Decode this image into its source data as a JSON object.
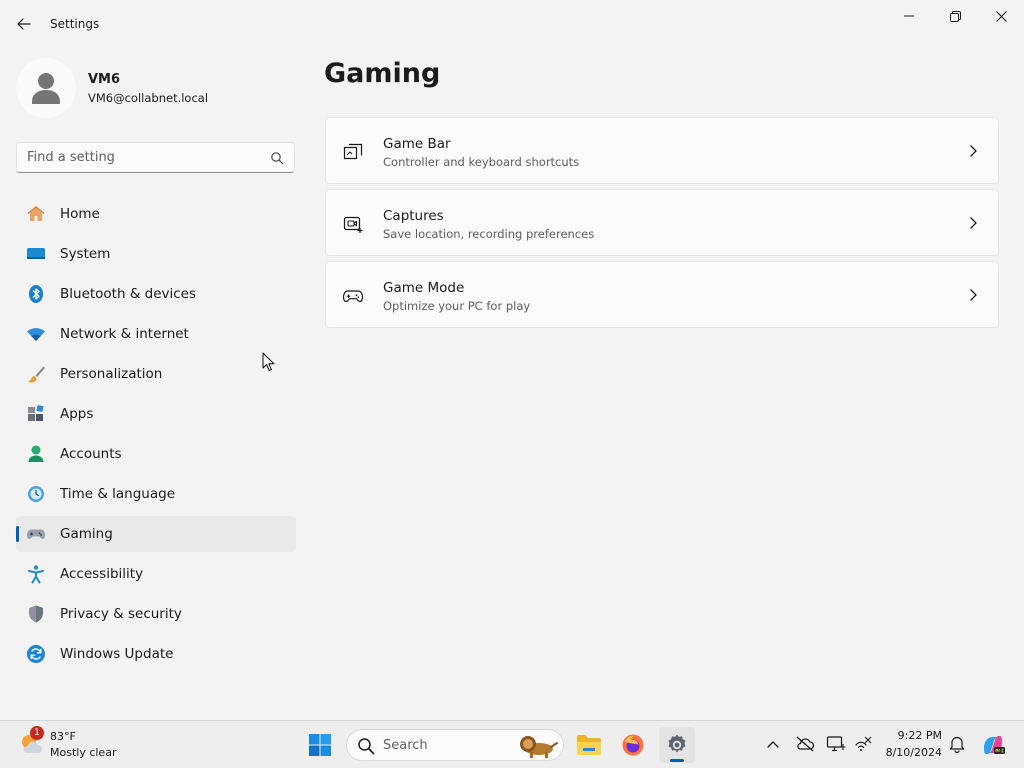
{
  "window": {
    "title": "Settings"
  },
  "profile": {
    "name": "VM6",
    "email": "VM6@collabnet.local"
  },
  "search": {
    "placeholder": "Find a setting"
  },
  "sidebar": {
    "items": [
      {
        "label": "Home",
        "icon": "home-icon"
      },
      {
        "label": "System",
        "icon": "display-icon"
      },
      {
        "label": "Bluetooth & devices",
        "icon": "bluetooth-icon"
      },
      {
        "label": "Network & internet",
        "icon": "wifi-icon"
      },
      {
        "label": "Personalization",
        "icon": "brush-icon"
      },
      {
        "label": "Apps",
        "icon": "apps-icon"
      },
      {
        "label": "Accounts",
        "icon": "person-icon"
      },
      {
        "label": "Time & language",
        "icon": "clock-globe-icon"
      },
      {
        "label": "Gaming",
        "icon": "gamepad-icon",
        "active": true
      },
      {
        "label": "Accessibility",
        "icon": "accessibility-icon"
      },
      {
        "label": "Privacy & security",
        "icon": "shield-icon"
      },
      {
        "label": "Windows Update",
        "icon": "refresh-icon"
      }
    ]
  },
  "main": {
    "title": "Gaming",
    "cards": [
      {
        "title": "Game Bar",
        "description": "Controller and keyboard shortcuts",
        "icon": "game-bar-icon"
      },
      {
        "title": "Captures",
        "description": "Save location, recording preferences",
        "icon": "capture-icon"
      },
      {
        "title": "Game Mode",
        "description": "Optimize your PC for play",
        "icon": "gamepad-icon"
      }
    ]
  },
  "taskbar": {
    "weather": {
      "temp": "83°F",
      "condition": "Mostly clear",
      "badge": "1"
    },
    "search_label": "Search",
    "clock": {
      "time": "9:22 PM",
      "date": "8/10/2024"
    }
  },
  "colors": {
    "accent": "#005fb8",
    "background": "#f3f3f3",
    "card": "#fbfbfb"
  }
}
